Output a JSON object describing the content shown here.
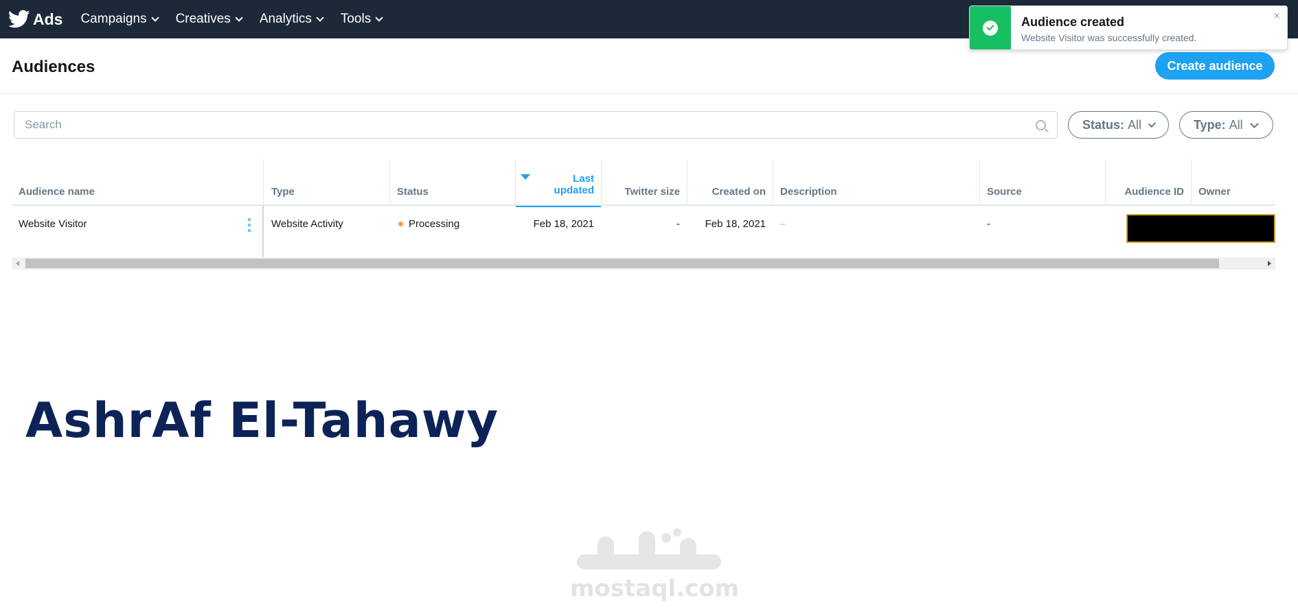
{
  "nav": {
    "brand": "Ads",
    "items": [
      {
        "label": "Campaigns"
      },
      {
        "label": "Creatives"
      },
      {
        "label": "Analytics"
      },
      {
        "label": "Tools"
      }
    ]
  },
  "toast": {
    "title": "Audience created",
    "message": "Website Visitor was successfully created.",
    "close": "×",
    "accent": "#17bf63"
  },
  "page": {
    "title": "Audiences",
    "create_label": "Create audience"
  },
  "search": {
    "placeholder": "Search",
    "value": ""
  },
  "filters": {
    "status": {
      "label": "Status:",
      "value": "All"
    },
    "type": {
      "label": "Type:",
      "value": "All"
    }
  },
  "table": {
    "headers": {
      "name": "Audience name",
      "type": "Type",
      "status": "Status",
      "last_updated_1": "Last",
      "last_updated_2": "updated",
      "twitter_size": "Twitter size",
      "created_on": "Created on",
      "description": "Description",
      "source": "Source",
      "audience_id": "Audience ID",
      "owner": "Owner"
    },
    "rows": [
      {
        "name": "Website Visitor",
        "type": "Website Activity",
        "status": "Processing",
        "last_updated": "Feb 18, 2021",
        "twitter_size": "-",
        "created_on": "Feb 18, 2021",
        "description": "–",
        "source": "-"
      }
    ]
  },
  "overlay": {
    "author": "AshrAf El-Tahawy",
    "watermark": "mostaql.com"
  },
  "colors": {
    "nav_bg": "#1c2938",
    "primary": "#1da1f2",
    "processing": "#f5a623",
    "author_text": "#0d2357"
  }
}
